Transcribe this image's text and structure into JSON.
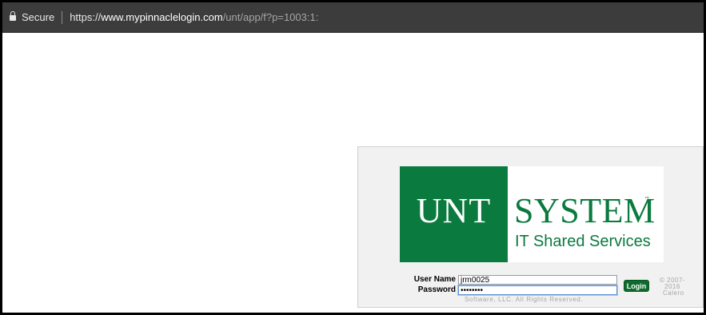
{
  "address_bar": {
    "secure_label": "Secure",
    "url_scheme": "https://",
    "url_host": "www.mypinnaclelogin.com",
    "url_path": "/unt/app/f?p=1003:1:"
  },
  "logo": {
    "left_text": "UNT",
    "right_text": "SYSTEM",
    "trademark": "™",
    "subtitle": "IT Shared Services"
  },
  "login_form": {
    "username_label": "User Name",
    "username_value": "jrm0025",
    "password_label": "Password",
    "password_value": "••••••••",
    "login_button": "Login"
  },
  "copyright": {
    "side_lines": [
      "© 2007-",
      "2016",
      "Calero"
    ],
    "bottom_line": "Software, LLC. All Rights Reserved."
  },
  "colors": {
    "brand_green": "#0b7a3e",
    "button_green": "#0e6b2f",
    "address_bar_bg": "#3c3c3c"
  }
}
